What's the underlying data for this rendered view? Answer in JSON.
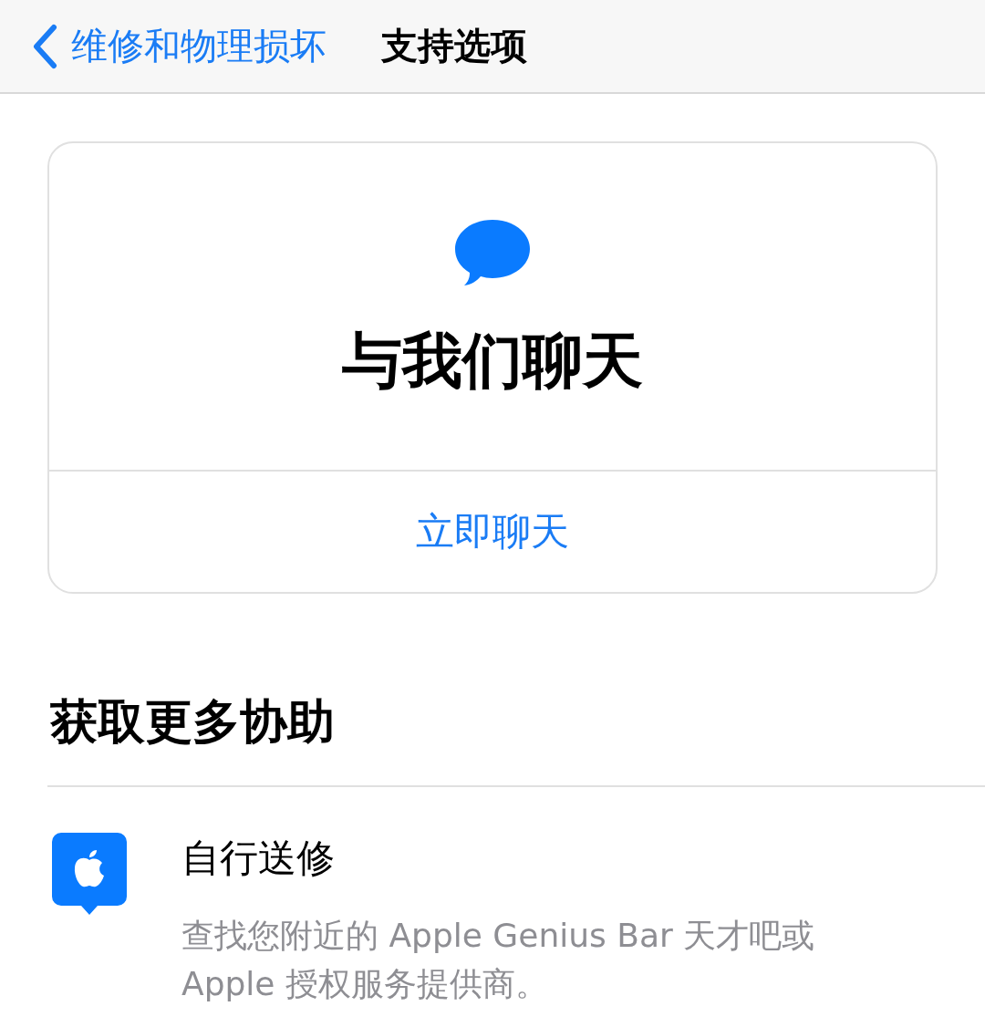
{
  "nav_bar": {
    "back_label": "维修和物理损坏",
    "title": "支持选项"
  },
  "chat_card": {
    "title": "与我们聊天",
    "action": "立即聊天"
  },
  "section": {
    "title": "获取更多协助",
    "items": [
      {
        "title": "自行送修",
        "description": "查找您附近的 Apple Genius Bar 天才吧或 Apple 授权服务提供商。"
      }
    ]
  }
}
